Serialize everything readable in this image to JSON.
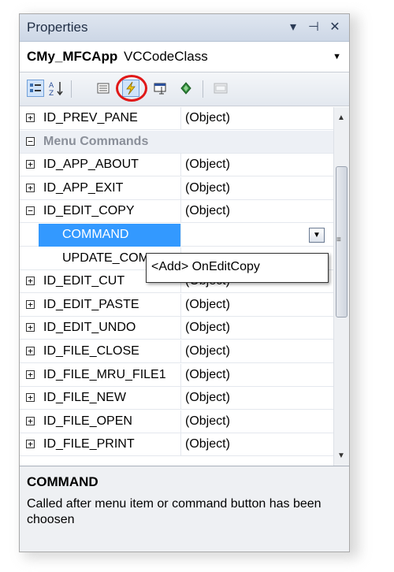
{
  "window": {
    "title": "Properties",
    "pin_glyph": "⊣",
    "close_glyph": "✕",
    "menu_glyph": "▾"
  },
  "object_selector": {
    "name": "CMy_MFCApp",
    "type": "VCCodeClass"
  },
  "toolbar": {
    "buttons": [
      {
        "icon": "categorized-icon"
      },
      {
        "icon": "alphabetical-icon"
      },
      {
        "icon": "properties-icon"
      },
      {
        "icon": "events-icon",
        "highlighted": true
      },
      {
        "icon": "messages-icon"
      },
      {
        "icon": "overrides-icon"
      },
      {
        "icon": "property-pages-icon"
      }
    ],
    "highlight_color": "#e01818"
  },
  "grid": {
    "rows": [
      {
        "name": "ID_PREV_PANE",
        "value": "(Object)",
        "expander": "+"
      },
      {
        "name": "Menu Commands",
        "value": "",
        "expander": "−",
        "category": true
      },
      {
        "name": "ID_APP_ABOUT",
        "value": "(Object)",
        "expander": "+"
      },
      {
        "name": "ID_APP_EXIT",
        "value": "(Object)",
        "expander": "+"
      },
      {
        "name": "ID_EDIT_COPY",
        "value": "(Object)",
        "expander": "−"
      },
      {
        "name": "COMMAND",
        "value": "",
        "expander": "",
        "selected": true,
        "indent": true
      },
      {
        "name": "UPDATE_COMMAND_UI",
        "value": "",
        "expander": "",
        "indent": true
      },
      {
        "name": "ID_EDIT_CUT",
        "value": "(Object)",
        "expander": "+"
      },
      {
        "name": "ID_EDIT_PASTE",
        "value": "(Object)",
        "expander": "+"
      },
      {
        "name": "ID_EDIT_UNDO",
        "value": "(Object)",
        "expander": "+"
      },
      {
        "name": "ID_FILE_CLOSE",
        "value": "(Object)",
        "expander": "+"
      },
      {
        "name": "ID_FILE_MRU_FILE1",
        "value": "(Object)",
        "expander": "+"
      },
      {
        "name": "ID_FILE_NEW",
        "value": "(Object)",
        "expander": "+"
      },
      {
        "name": "ID_FILE_OPEN",
        "value": "(Object)",
        "expander": "+"
      },
      {
        "name": "ID_FILE_PRINT",
        "value": "(Object)",
        "expander": "+"
      }
    ],
    "dropdown_option": "<Add> OnEditCopy",
    "selection_color": "#3399ff"
  },
  "description": {
    "title": "COMMAND",
    "text": "Called after menu item or command button has been choosen"
  }
}
